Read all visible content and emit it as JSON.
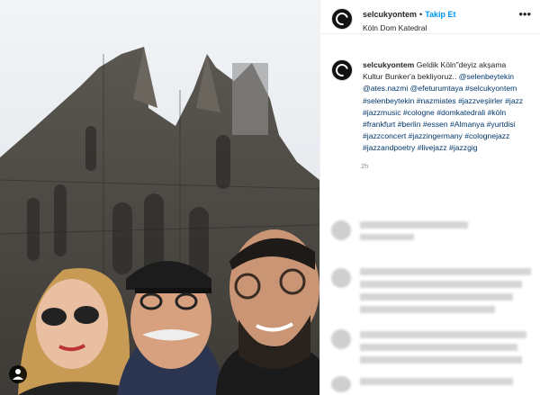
{
  "post": {
    "username": "selcukyontem",
    "separator": "•",
    "follow_label": "Takip Et",
    "location": "Köln Dom Katedral",
    "more_icon": "more-horizontal-icon",
    "caption_username": "selcukyontem",
    "caption_intro": "Geldik Köln\"deyiz akşama Kultur Bunker'a bekliyoruz..",
    "caption_tags": [
      "@selenbeytekin",
      "@ates.nazmi",
      "@efeturumtaya",
      "#selcukyontem",
      "#selenbeytekin",
      "#nazmiates",
      "#jazzveşiirler",
      "#jazz",
      "#jazzmusic",
      "#cologne",
      "#domkatedrali",
      "#köln",
      "#frankfurt",
      "#berlin",
      "#essen",
      "#Almanya",
      "#yurtdisi",
      "#jazzconcert",
      "#jazzingermany",
      "#colognejazz",
      "#jazzandpoetry",
      "#livejazz",
      "#jazzgig"
    ],
    "time": "2h"
  },
  "colors": {
    "link": "#00376b",
    "follow": "#0095f6",
    "border": "#efefef"
  }
}
